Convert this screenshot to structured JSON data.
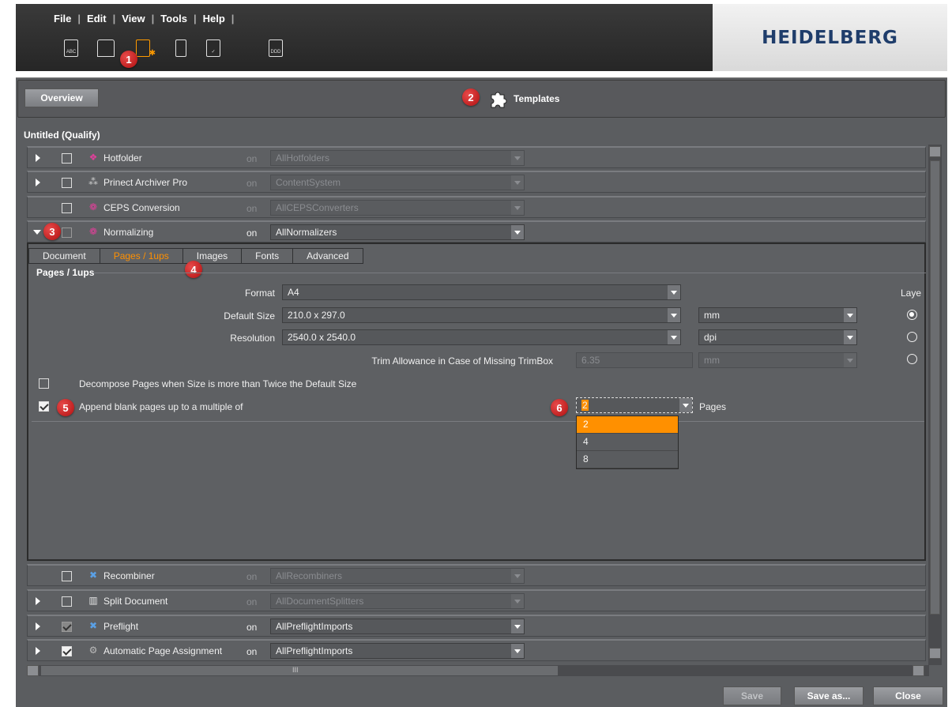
{
  "menu": [
    "File",
    "Edit",
    "View",
    "Tools",
    "Help"
  ],
  "toolbar_icons": [
    "abc-document-icon",
    "printer-icon",
    "monitor-gear-icon",
    "tower-icon",
    "signed-document-icon",
    "ddd-document-icon"
  ],
  "logo": "HEIDELBERG",
  "header": {
    "overview_label": "Overview",
    "templates_label": "Templates"
  },
  "badges": [
    "1",
    "2",
    "3",
    "4",
    "5",
    "6"
  ],
  "section_title": "Untitled (Qualify)",
  "rows": {
    "hotfolder": {
      "name": "Hotfolder",
      "on": "on",
      "value": "AllHotfolders"
    },
    "archiver": {
      "name": "Prinect Archiver Pro",
      "on": "on",
      "value": "ContentSystem"
    },
    "ceps": {
      "name": "CEPS Conversion",
      "on": "on",
      "value": "AllCEPSConverters"
    },
    "normalizing": {
      "name": "Normalizing",
      "on": "on",
      "value": "AllNormalizers"
    },
    "recombiner": {
      "name": "Recombiner",
      "on": "on",
      "value": "AllRecombiners"
    },
    "split": {
      "name": "Split Document",
      "on": "on",
      "value": "AllDocumentSplitters"
    },
    "preflight": {
      "name": "Preflight",
      "on": "on",
      "value": "AllPreflightImports"
    },
    "page_assignment": {
      "name": "Automatic Page Assignment",
      "on": "on",
      "value": "AllPreflightImports"
    }
  },
  "tabs": [
    "Document",
    "Pages / 1ups",
    "Images",
    "Fonts",
    "Advanced"
  ],
  "pages_group": {
    "title": "Pages / 1ups",
    "format_label": "Format",
    "format_value": "A4",
    "default_size_label": "Default Size",
    "default_size_value": "210.0 x 297.0",
    "size_unit": "mm",
    "resolution_label": "Resolution",
    "resolution_value": "2540.0 x 2540.0",
    "resolution_unit": "dpi",
    "trim_label": "Trim Allowance in Case of Missing TrimBox",
    "trim_value": "6.35",
    "trim_unit": "mm",
    "layout_label": "Laye",
    "decompose_label": "Decompose Pages when Size is more than Twice the Default Size",
    "append_label": "Append blank pages up to a multiple of",
    "append_value": "2",
    "pages_label": "Pages",
    "options": [
      "2",
      "4",
      "8"
    ]
  },
  "scrollbar_text": "III",
  "buttons": {
    "save": "Save",
    "save_as": "Save as...",
    "close": "Close"
  }
}
